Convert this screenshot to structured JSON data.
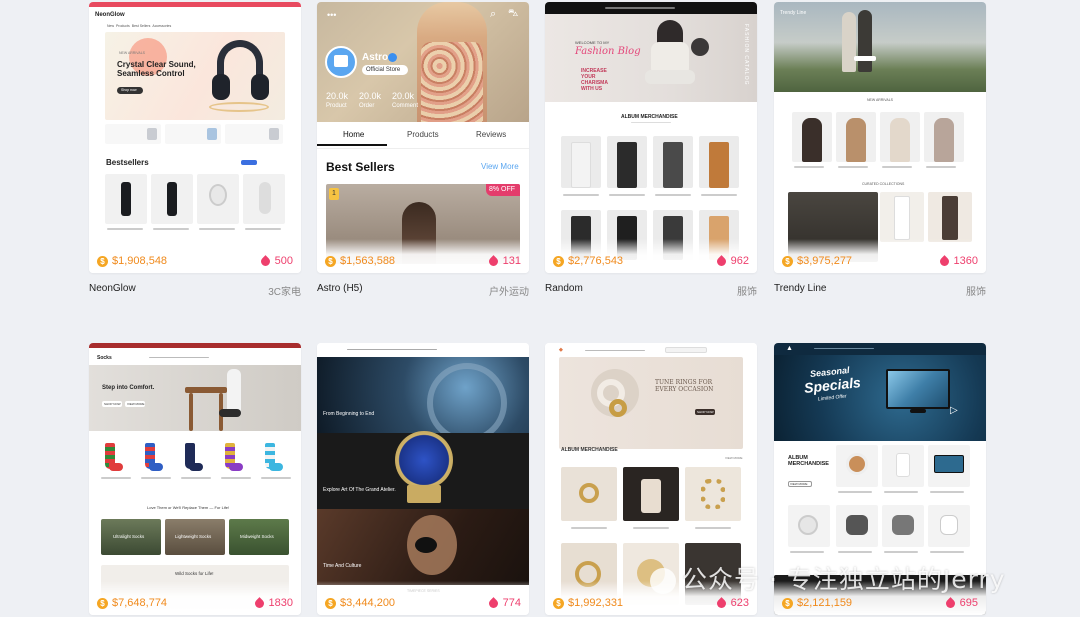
{
  "templates": [
    {
      "name": "NeonGlow",
      "category": "3C家电",
      "price": "$1,908,548",
      "likes": "500",
      "preview": {
        "brand": "NeonGlow",
        "nav": [
          "New",
          "Products",
          "Best Sellers",
          "Accessories"
        ],
        "badge": "NEW ARRIVALS",
        "hero_title": "Crystal Clear Sound, Seamless Control",
        "hero_button": "Shop now",
        "section_title": "Bestsellers"
      }
    },
    {
      "name": "Astro (H5)",
      "category": "户外运动",
      "price": "$1,563,588",
      "likes": "131",
      "preview": {
        "store_name": "Astro",
        "store_badge": "Official Store",
        "stats": [
          {
            "value": "20.0k",
            "label": "Product"
          },
          {
            "value": "20.0k",
            "label": "Order"
          },
          {
            "value": "20.0k",
            "label": "Comment"
          }
        ],
        "tabs": [
          "Home",
          "Products",
          "Reviews"
        ],
        "section_title": "Best Sellers",
        "view_more": "View More",
        "discount": "8% OFF",
        "rank": "1"
      }
    },
    {
      "name": "Random",
      "category": "服饰",
      "price": "$2,776,543",
      "likes": "962",
      "preview": {
        "welcome": "WELCOME TO MY",
        "blog": "Fashion Blog",
        "tagline": "INCREASE YOUR CHARISMA WITH US",
        "side_text": "FASHION CATALOG",
        "section_title": "ALBUM MERCHANDISE"
      }
    },
    {
      "name": "Trendy Line",
      "category": "服饰",
      "price": "$3,975,277",
      "likes": "1360",
      "preview": {
        "brand": "Trendy Line",
        "section1": "NEW ARRIVALS",
        "section2": "CURATED COLLECTIONS"
      }
    },
    {
      "name": "",
      "category": "",
      "price": "$7,648,774",
      "likes": "1830",
      "preview": {
        "brand": "Socks",
        "hero_title": "Step into Comfort.",
        "hero_btn1": "SHOP NOW",
        "hero_btn2": "VIEW MORE",
        "promise": "Love Them or We'll Replace Them — For Life!",
        "tiles": [
          "Ultralight Socks",
          "Lightweight Socks",
          "Midweight Socks"
        ],
        "footer_banner": "Wild Socks for Life!"
      }
    },
    {
      "name": "",
      "category": "",
      "price": "$3,444,200",
      "likes": "774",
      "preview": {
        "banner1": "From Beginning to End",
        "banner2": "Explore Art Of The Grand Atelier.",
        "banner3": "Time And Culture",
        "footer": "TIMEPIECE SERIES"
      }
    },
    {
      "name": "",
      "category": "",
      "price": "$1,992,331",
      "likes": "623",
      "preview": {
        "hero_title": "TUNE RINGS FOR EVERY OCCASION",
        "hero_button": "SHOP NOW",
        "section_title": "ALBUM MERCHANDISE",
        "view_more": "VIEW MORE"
      }
    },
    {
      "name": "",
      "category": "",
      "price": "$2,121,159",
      "likes": "695",
      "preview": {
        "hero_line1": "Seasonal",
        "hero_line2": "Specials",
        "hero_line3": "Limited Offer",
        "section_title": "ALBUM MERCHANDISE",
        "button": "VIEW MORE"
      }
    }
  ],
  "watermark": "公众号 · 专注独立站的Jerry",
  "colors": {
    "price": "#f08a1c",
    "likes": "#ee3f6d",
    "coin": "#f5a623"
  }
}
